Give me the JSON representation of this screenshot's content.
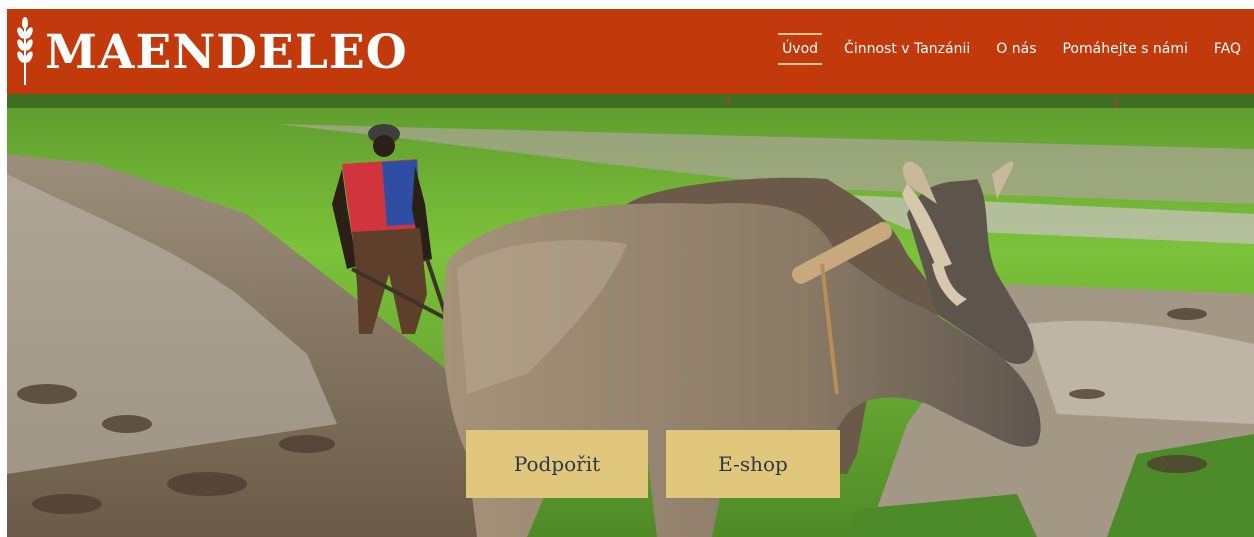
{
  "brand": {
    "name": "MAENDELEO",
    "logo_icon": "wheat-icon"
  },
  "nav": {
    "items": [
      {
        "label": "Úvod",
        "active": true
      },
      {
        "label": "Činnost v Tanzánii",
        "active": false
      },
      {
        "label": "O nás",
        "active": false
      },
      {
        "label": "Pomáhejte s námi",
        "active": false
      },
      {
        "label": "FAQ",
        "active": false
      }
    ]
  },
  "hero": {
    "image": "farmer-plowing-with-oxen-illustration",
    "buttons": {
      "support_label": "Podpořit",
      "eshop_label": "E-shop"
    }
  },
  "colors": {
    "header_bg": "#c23a0c",
    "button_bg": "#e0c77b",
    "active_underline": "#e9c98a"
  }
}
